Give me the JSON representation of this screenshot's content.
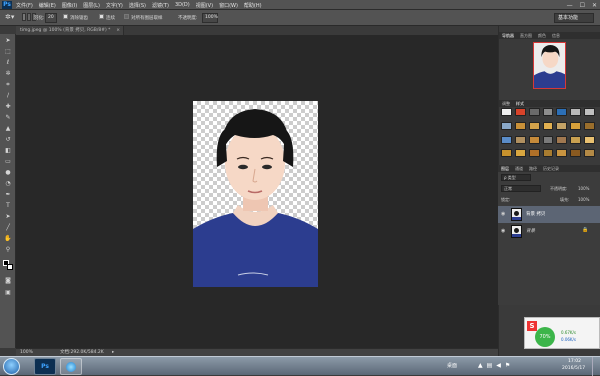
{
  "app": {
    "logo": "Ps",
    "menus": [
      "文件(F)",
      "编辑(E)",
      "图像(I)",
      "图层(L)",
      "文字(Y)",
      "选择(S)",
      "滤镜(T)",
      "3D(D)",
      "视图(V)",
      "窗口(W)",
      "帮助(H)"
    ],
    "window_controls": [
      "—",
      "☐",
      "✕"
    ]
  },
  "options": {
    "feather_label": "羽化:",
    "feather_value": "20",
    "antialias_label": "消除锯齿",
    "contiguous_label": "连续",
    "sample_all_label": "对所有图层取样",
    "opacity_label": "不透明度:",
    "opacity_value": "100%",
    "workspace": "基本功能"
  },
  "document": {
    "tab_title": "timg.jpeg @ 100% (背景 拷贝, RGB/8#) *",
    "close": "×"
  },
  "status": {
    "zoom": "100%",
    "doc_size": "文档:292.0K/584.2K"
  },
  "panels": {
    "top_tabs": [
      "导航器",
      "直方图",
      "颜色",
      "信息"
    ],
    "mid_tabs": [
      "调整",
      "样式"
    ],
    "layer_tabs": [
      "图层",
      "通道",
      "路径",
      "历史记录"
    ],
    "layer_filter": "ρ 类型",
    "blend_mode": "正常",
    "opacity_label": "不透明度:",
    "opacity_value": "100%",
    "lock_label": "锁定:",
    "fill_label": "填充:",
    "fill_value": "100%",
    "layers": [
      {
        "name": "背景 拷贝",
        "selected": true
      },
      {
        "name": "背景",
        "selected": false
      }
    ]
  },
  "swatches": [
    "#f0f0f0",
    "#d8432a",
    "#6a6a6a",
    "#8e8e8e",
    "#2c6fb6",
    "#b8b8b8",
    "#c0c0c0",
    "#8aa8c8",
    "#c89038",
    "#d2a24a",
    "#e2b050",
    "#c3a266",
    "#d6a03a",
    "#9a6e2c",
    "#5a8cc8",
    "#b09060",
    "#c58a3a",
    "#7a7a7a",
    "#a07850",
    "#c8a050",
    "#e8c070",
    "#c7922d",
    "#d8a640",
    "#b07028",
    "#a87c30",
    "#c89440",
    "#8a5a20",
    "#b48a46"
  ],
  "tray": {
    "ime": "S",
    "percent": "70%",
    "upload": "0.67K/s",
    "download": "0.06K/s",
    "desktop": "桌面",
    "time": "17:02",
    "date": "2016/5/17"
  }
}
